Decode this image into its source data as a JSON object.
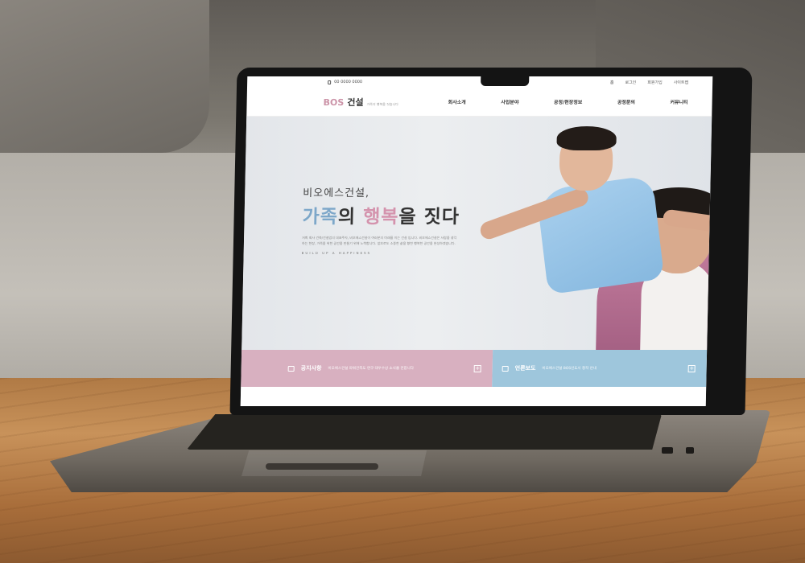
{
  "utility": {
    "phone": "00 0000 0000",
    "links": [
      "홈",
      "로그인",
      "회원가입",
      "사이트맵"
    ]
  },
  "logo": {
    "brand": "BOS",
    "name": "건설",
    "tagline": "가족의 행복을 짓습니다"
  },
  "menu": [
    "회사소개",
    "사업분야",
    "공정/현장정보",
    "공정문의",
    "커뮤니티"
  ],
  "hero": {
    "subtitle": "비오에스건설,",
    "title_part1": "가족",
    "title_part2": "의 ",
    "title_part3": "행복",
    "title_part4": "을 짓다",
    "description": "저희 회사 건축/건설업의 대표주자, 비오에스건설이 여러분의 미래를 지는 건설 입니다. 비오에스건설은 사람을 생각하는 현장, 가족을 위한 공간을 만들기 위해 노력합니다. 앞으로도 소중한 삶을 향한 행복한 공간을 완성하겠습니다.",
    "footer": "BUILD UP A HAPPINESS"
  },
  "panels": {
    "notice": {
      "title": "공지사항",
      "text": "비오에스건설 파워건축도 연구 대우수상 소식을 전합니다"
    },
    "press": {
      "title": "언론보도",
      "text": "비오에스건설 BOS인도시 창작 안내"
    }
  },
  "colors": {
    "brand_pink": "#cc94a8",
    "accent_blue": "#7da7c9",
    "notice_bg": "#d8b0c0",
    "press_bg": "#9ec6dc"
  }
}
